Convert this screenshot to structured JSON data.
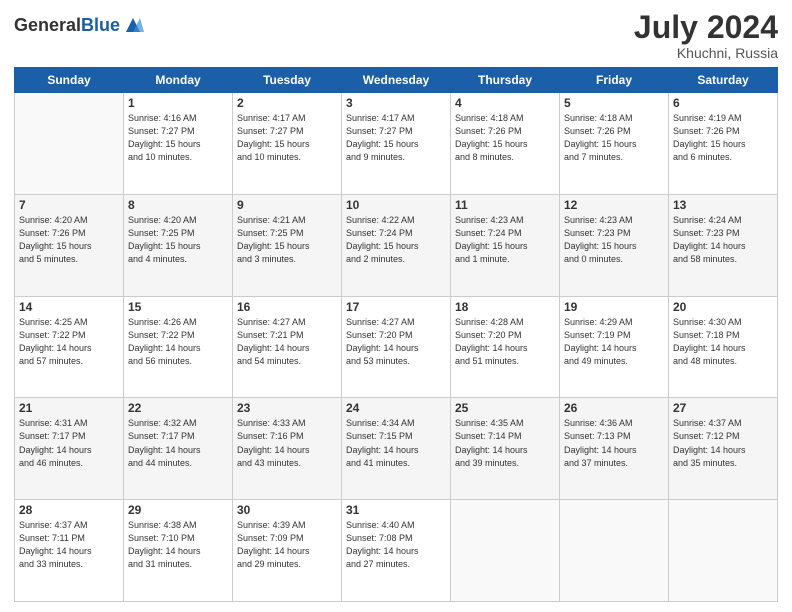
{
  "header": {
    "logo_general": "General",
    "logo_blue": "Blue",
    "month_year": "July 2024",
    "location": "Khuchni, Russia"
  },
  "weekdays": [
    "Sunday",
    "Monday",
    "Tuesday",
    "Wednesday",
    "Thursday",
    "Friday",
    "Saturday"
  ],
  "weeks": [
    [
      {
        "day": "",
        "info": ""
      },
      {
        "day": "1",
        "info": "Sunrise: 4:16 AM\nSunset: 7:27 PM\nDaylight: 15 hours\nand 10 minutes."
      },
      {
        "day": "2",
        "info": "Sunrise: 4:17 AM\nSunset: 7:27 PM\nDaylight: 15 hours\nand 10 minutes."
      },
      {
        "day": "3",
        "info": "Sunrise: 4:17 AM\nSunset: 7:27 PM\nDaylight: 15 hours\nand 9 minutes."
      },
      {
        "day": "4",
        "info": "Sunrise: 4:18 AM\nSunset: 7:26 PM\nDaylight: 15 hours\nand 8 minutes."
      },
      {
        "day": "5",
        "info": "Sunrise: 4:18 AM\nSunset: 7:26 PM\nDaylight: 15 hours\nand 7 minutes."
      },
      {
        "day": "6",
        "info": "Sunrise: 4:19 AM\nSunset: 7:26 PM\nDaylight: 15 hours\nand 6 minutes."
      }
    ],
    [
      {
        "day": "7",
        "info": "Sunrise: 4:20 AM\nSunset: 7:26 PM\nDaylight: 15 hours\nand 5 minutes."
      },
      {
        "day": "8",
        "info": "Sunrise: 4:20 AM\nSunset: 7:25 PM\nDaylight: 15 hours\nand 4 minutes."
      },
      {
        "day": "9",
        "info": "Sunrise: 4:21 AM\nSunset: 7:25 PM\nDaylight: 15 hours\nand 3 minutes."
      },
      {
        "day": "10",
        "info": "Sunrise: 4:22 AM\nSunset: 7:24 PM\nDaylight: 15 hours\nand 2 minutes."
      },
      {
        "day": "11",
        "info": "Sunrise: 4:23 AM\nSunset: 7:24 PM\nDaylight: 15 hours\nand 1 minute."
      },
      {
        "day": "12",
        "info": "Sunrise: 4:23 AM\nSunset: 7:23 PM\nDaylight: 15 hours\nand 0 minutes."
      },
      {
        "day": "13",
        "info": "Sunrise: 4:24 AM\nSunset: 7:23 PM\nDaylight: 14 hours\nand 58 minutes."
      }
    ],
    [
      {
        "day": "14",
        "info": "Sunrise: 4:25 AM\nSunset: 7:22 PM\nDaylight: 14 hours\nand 57 minutes."
      },
      {
        "day": "15",
        "info": "Sunrise: 4:26 AM\nSunset: 7:22 PM\nDaylight: 14 hours\nand 56 minutes."
      },
      {
        "day": "16",
        "info": "Sunrise: 4:27 AM\nSunset: 7:21 PM\nDaylight: 14 hours\nand 54 minutes."
      },
      {
        "day": "17",
        "info": "Sunrise: 4:27 AM\nSunset: 7:20 PM\nDaylight: 14 hours\nand 53 minutes."
      },
      {
        "day": "18",
        "info": "Sunrise: 4:28 AM\nSunset: 7:20 PM\nDaylight: 14 hours\nand 51 minutes."
      },
      {
        "day": "19",
        "info": "Sunrise: 4:29 AM\nSunset: 7:19 PM\nDaylight: 14 hours\nand 49 minutes."
      },
      {
        "day": "20",
        "info": "Sunrise: 4:30 AM\nSunset: 7:18 PM\nDaylight: 14 hours\nand 48 minutes."
      }
    ],
    [
      {
        "day": "21",
        "info": "Sunrise: 4:31 AM\nSunset: 7:17 PM\nDaylight: 14 hours\nand 46 minutes."
      },
      {
        "day": "22",
        "info": "Sunrise: 4:32 AM\nSunset: 7:17 PM\nDaylight: 14 hours\nand 44 minutes."
      },
      {
        "day": "23",
        "info": "Sunrise: 4:33 AM\nSunset: 7:16 PM\nDaylight: 14 hours\nand 43 minutes."
      },
      {
        "day": "24",
        "info": "Sunrise: 4:34 AM\nSunset: 7:15 PM\nDaylight: 14 hours\nand 41 minutes."
      },
      {
        "day": "25",
        "info": "Sunrise: 4:35 AM\nSunset: 7:14 PM\nDaylight: 14 hours\nand 39 minutes."
      },
      {
        "day": "26",
        "info": "Sunrise: 4:36 AM\nSunset: 7:13 PM\nDaylight: 14 hours\nand 37 minutes."
      },
      {
        "day": "27",
        "info": "Sunrise: 4:37 AM\nSunset: 7:12 PM\nDaylight: 14 hours\nand 35 minutes."
      }
    ],
    [
      {
        "day": "28",
        "info": "Sunrise: 4:37 AM\nSunset: 7:11 PM\nDaylight: 14 hours\nand 33 minutes."
      },
      {
        "day": "29",
        "info": "Sunrise: 4:38 AM\nSunset: 7:10 PM\nDaylight: 14 hours\nand 31 minutes."
      },
      {
        "day": "30",
        "info": "Sunrise: 4:39 AM\nSunset: 7:09 PM\nDaylight: 14 hours\nand 29 minutes."
      },
      {
        "day": "31",
        "info": "Sunrise: 4:40 AM\nSunset: 7:08 PM\nDaylight: 14 hours\nand 27 minutes."
      },
      {
        "day": "",
        "info": ""
      },
      {
        "day": "",
        "info": ""
      },
      {
        "day": "",
        "info": ""
      }
    ]
  ]
}
